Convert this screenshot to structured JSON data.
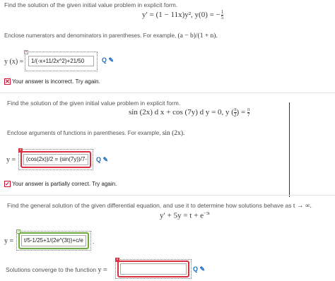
{
  "q1": {
    "prompt": "Find the solution of the given initial value problem in explicit form.",
    "equation": "y′ = (1 − 11x)y², y(0) = −",
    "frac_num": "1",
    "frac_den": "5",
    "instruction": "Enclose numerators and denominators in parentheses. For example,",
    "instruction_example": "(a − b)/(1 + n).",
    "answer_label": "y (x) =",
    "answer_value": "1/(-x+11/2x^2)+21/50",
    "status": "Your answer is incorrect.  Try again.",
    "status_icon": "✕"
  },
  "q2": {
    "prompt": "Find the solution of the given initial value problem in explicit form.",
    "equation_a": "sin (2x) d x + cos (7y) d y = 0, y (",
    "frac_in_num": "π",
    "frac_in_den": "2",
    "equation_b": ") =",
    "frac_out_num": "π",
    "frac_out_den": "7",
    "instruction": "Enclose arguments of functions in parentheses. For example,",
    "instruction_example": "sin (2x).",
    "answer_label": "y =",
    "answer_value": "(cos(2x))/2 = (sin(7y))/7-",
    "status": "Your answer is partially correct.  Try again.",
    "status_icon": "✓"
  },
  "q3": {
    "prompt": "Find the general solution of the given differential equation, and use it to determine how solutions behave as",
    "prompt_limit": "t → ∞.",
    "equation": "y′ + 5y = t + e",
    "exponent": "−3t",
    "answer_label": "y =",
    "answer_value": "t/5-1/25+1/(2e^(3t))+c/e",
    "converge_label": "Solutions converge to the function",
    "converge_var": "y =",
    "converge_value": ""
  },
  "icons": {
    "search": "Q",
    "edit": "✎"
  },
  "colors": {
    "incorrect": "#d9303f",
    "correct": "#6cab3b",
    "tools": "#1d6fbf"
  }
}
